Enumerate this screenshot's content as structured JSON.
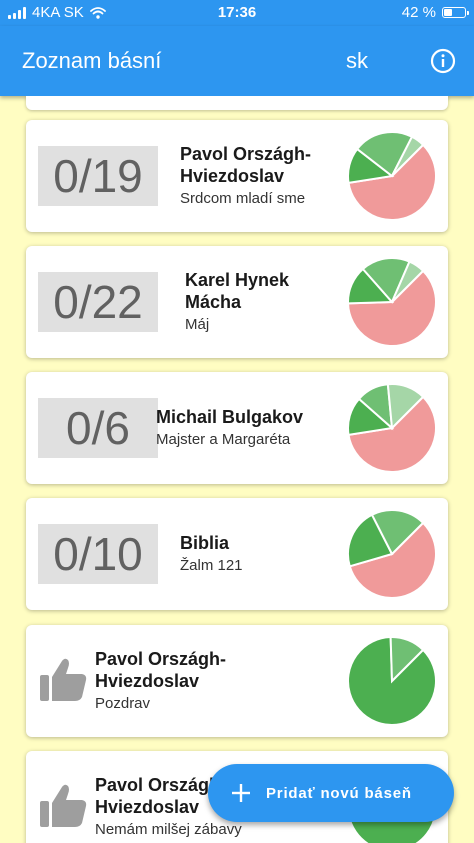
{
  "status_bar": {
    "carrier": "4KA SK",
    "time": "17:36",
    "battery": "42 %",
    "battery_level": 0.42
  },
  "app_bar": {
    "title": "Zoznam básní",
    "language": "sk",
    "info_icon": "info-icon"
  },
  "colors": {
    "primary": "#2d96f0",
    "background": "#fffdc2",
    "pie_red": "#f09a9a",
    "pie_green": "#4caf50",
    "pie_green_mid": "#6fbf73",
    "pie_green_light": "#a5d6a7"
  },
  "poems": [
    {
      "score": "0/19",
      "author": "Pavol Országh-Hviezdoslav",
      "title": "Srdcom mladí sme",
      "chart_data": {
        "type": "pie",
        "values": [
          60,
          13,
          22,
          5
        ]
      }
    },
    {
      "score": "0/22",
      "author": "Karel Hynek Mácha",
      "title": "Máj",
      "chart_data": {
        "type": "pie",
        "values": [
          62,
          14,
          18,
          6
        ]
      }
    },
    {
      "score": "0/6",
      "author": "Michail Bulgakov",
      "title": "Majster a Margaréta",
      "chart_data": {
        "type": "pie",
        "values": [
          60,
          14,
          12,
          14
        ]
      }
    },
    {
      "score": "0/10",
      "author": "Biblia",
      "title": "Žalm 121",
      "chart_data": {
        "type": "pie",
        "values": [
          58,
          22,
          20,
          0
        ]
      }
    },
    {
      "icon": "thumb-up-icon",
      "author": "Pavol Országh-Hviezdoslav",
      "title": "Pozdrav",
      "chart_data": {
        "type": "pie",
        "values": [
          0,
          87,
          13,
          0
        ]
      }
    },
    {
      "icon": "thumb-up-icon",
      "author": "Pavol Országh-Hviezdoslav",
      "title": "Nemám milšej zábavy",
      "chart_data": {
        "type": "pie",
        "values": [
          0,
          90,
          10,
          0
        ]
      }
    }
  ],
  "fab": {
    "label": "Pridať novú báseň",
    "icon": "plus-icon"
  }
}
